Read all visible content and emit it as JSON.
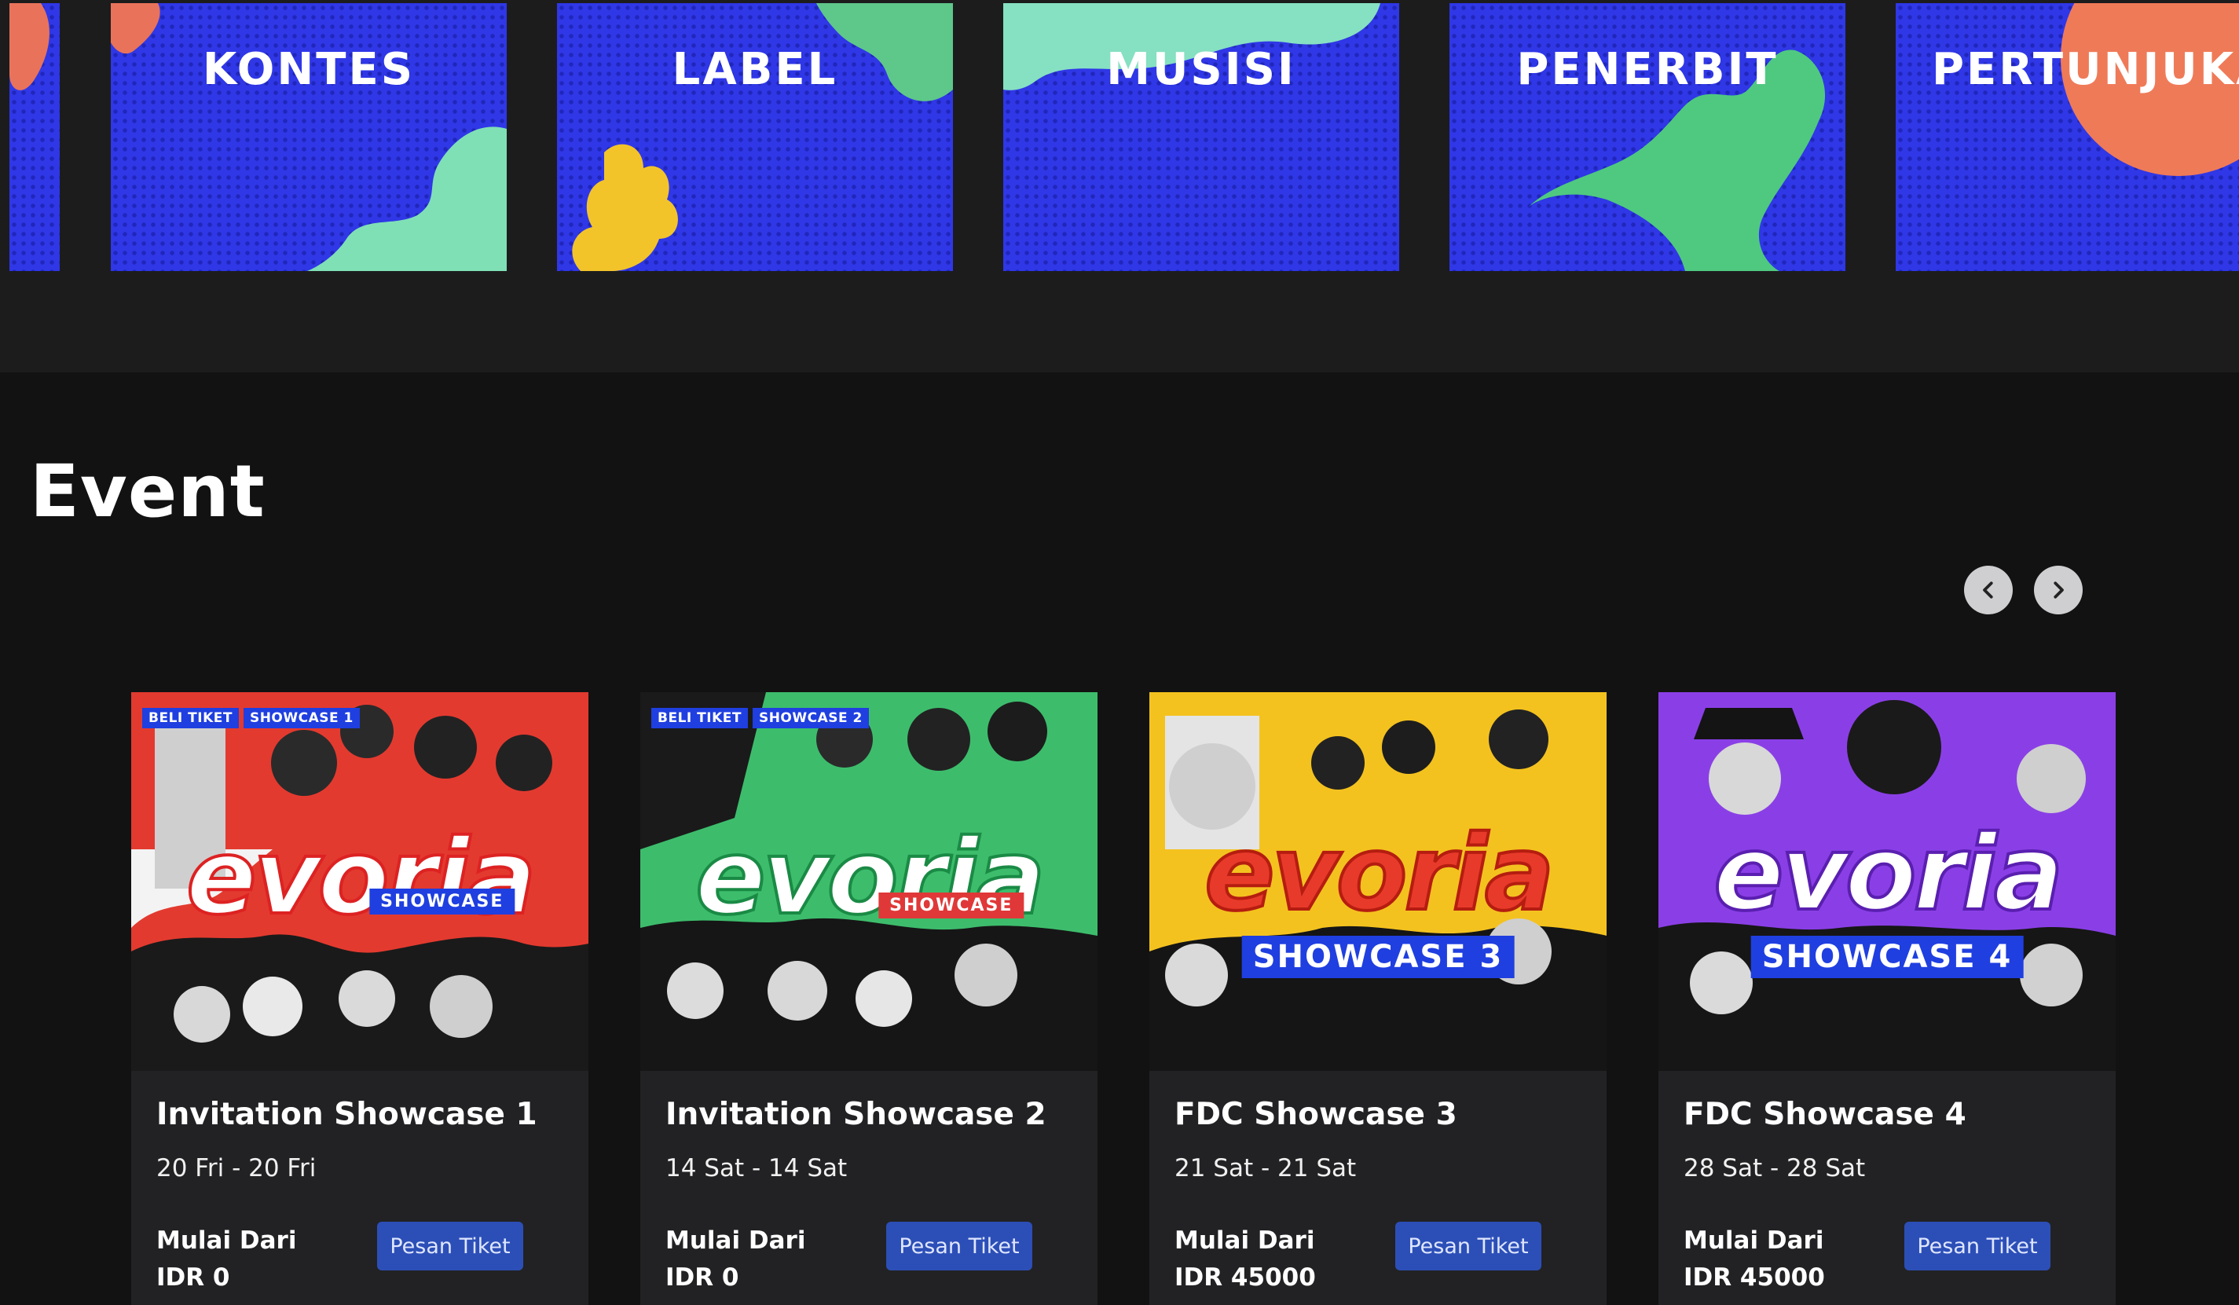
{
  "categories": [
    {
      "label": "KONTES"
    },
    {
      "label": "LABEL"
    },
    {
      "label": "MUSISI"
    },
    {
      "label": "PENERBIT"
    },
    {
      "label": "PERTUNJUKAN"
    }
  ],
  "section": {
    "title": "Event"
  },
  "events": [
    {
      "title": "Invitation Showcase 1",
      "date": "20 Fri - 20 Fri",
      "price_label": "Mulai Dari",
      "price": "IDR 0",
      "button": "Pesan Tiket",
      "chips": [
        "BELI TIKET",
        "SHOWCASE 1"
      ],
      "poster_word": "evoria",
      "poster_tag": "SHOWCASE",
      "poster_bg": "#e33a2f"
    },
    {
      "title": "Invitation Showcase 2",
      "date": "14 Sat - 14 Sat",
      "price_label": "Mulai Dari",
      "price": "IDR 0",
      "button": "Pesan Tiket",
      "chips": [
        "BELI TIKET",
        "SHOWCASE 2"
      ],
      "poster_word": "evoria",
      "poster_tag": "SHOWCASE",
      "poster_bg": "#3dbd6c"
    },
    {
      "title": "FDC Showcase 3",
      "date": "21 Sat - 21 Sat",
      "price_label": "Mulai Dari",
      "price": "IDR 45000",
      "button": "Pesan Tiket",
      "poster_word": "evoria",
      "poster_tag": "SHOWCASE 3",
      "poster_bg": "#f4c21f"
    },
    {
      "title": "FDC Showcase 4",
      "date": "28 Sat - 28 Sat",
      "price_label": "Mulai Dari",
      "price": "IDR 45000",
      "button": "Pesan Tiket",
      "poster_word": "evoria",
      "poster_tag": "SHOWCASE 4",
      "poster_bg": "#8a3fe6"
    }
  ],
  "colors": {
    "page_bg": "#121212",
    "category_blue": "#2f37e6",
    "card_bg": "#222224",
    "button_bg": "#2c4fb7"
  },
  "icons": {
    "prev": "chevron-left-icon",
    "next": "chevron-right-icon"
  }
}
